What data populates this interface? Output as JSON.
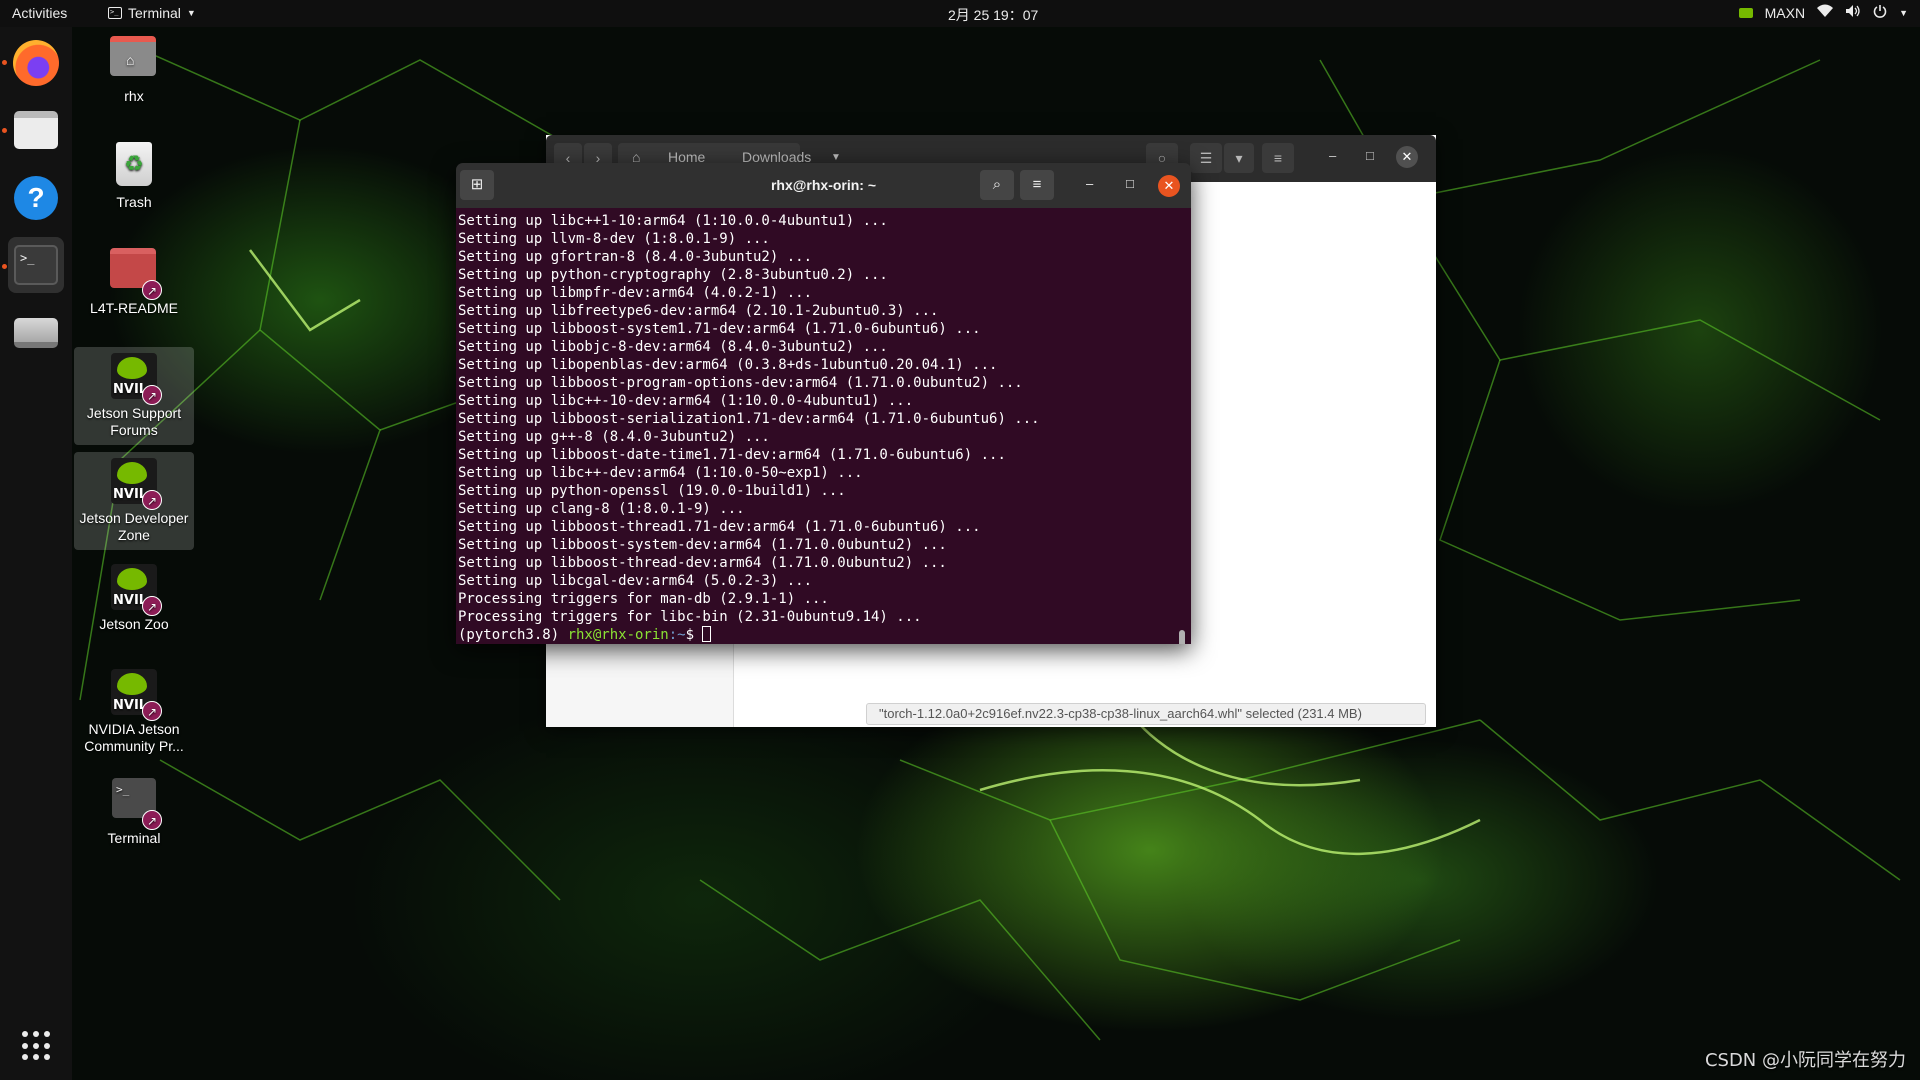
{
  "topbar": {
    "activities": "Activities",
    "app_menu_label": "Terminal",
    "clock": "2月 25 19：07",
    "power_mode": "MAXN"
  },
  "dock": {
    "items": [
      {
        "name": "Firefox",
        "icon": "firefox-icon",
        "running": true
      },
      {
        "name": "Files",
        "icon": "files-icon",
        "running": true
      },
      {
        "name": "Help",
        "icon": "help-icon",
        "running": false
      },
      {
        "name": "Terminal",
        "icon": "terminal-icon",
        "running": true,
        "active": true
      },
      {
        "name": "Drive",
        "icon": "drive-icon",
        "running": false
      }
    ],
    "show_apps_icon": "apps-grid-icon"
  },
  "desktop": {
    "icons": [
      {
        "label": "rhx",
        "icon": "home-folder-icon"
      },
      {
        "label": "Trash",
        "icon": "trash-icon"
      },
      {
        "label": "L4T-README",
        "icon": "folder-link-icon"
      },
      {
        "label": "Jetson Support Forums",
        "icon": "nvidia-link-icon"
      },
      {
        "label": "Jetson Developer Zone",
        "icon": "nvidia-link-icon"
      },
      {
        "label": "Jetson Zoo",
        "icon": "nvidia-link-icon"
      },
      {
        "label": "NVIDIA Jetson Community Pr...",
        "icon": "nvidia-link-icon"
      },
      {
        "label": "Terminal",
        "icon": "terminal-link-icon"
      }
    ],
    "nvidia_logo_text": "NVIL"
  },
  "files_window": {
    "crumb_home": "Home",
    "crumb_current": "Downloads",
    "status": "\"torch-1.12.0a0+2c916ef.nv22.3-cp38-cp38-linux_aarch64.whl\" selected  (231.4 MB)"
  },
  "terminal": {
    "title": "rhx@rhx-orin: ~",
    "lines": [
      "Setting up libc++1-10:arm64 (1:10.0.0-4ubuntu1) ...",
      "Setting up llvm-8-dev (1:8.0.1-9) ...",
      "Setting up gfortran-8 (8.4.0-3ubuntu2) ...",
      "Setting up python-cryptography (2.8-3ubuntu0.2) ...",
      "Setting up libmpfr-dev:arm64 (4.0.2-1) ...",
      "Setting up libfreetype6-dev:arm64 (2.10.1-2ubuntu0.3) ...",
      "Setting up libboost-system1.71-dev:arm64 (1.71.0-6ubuntu6) ...",
      "Setting up libobjc-8-dev:arm64 (8.4.0-3ubuntu2) ...",
      "Setting up libopenblas-dev:arm64 (0.3.8+ds-1ubuntu0.20.04.1) ...",
      "Setting up libboost-program-options-dev:arm64 (1.71.0.0ubuntu2) ...",
      "Setting up libc++-10-dev:arm64 (1:10.0.0-4ubuntu1) ...",
      "Setting up libboost-serialization1.71-dev:arm64 (1.71.0-6ubuntu6) ...",
      "Setting up g++-8 (8.4.0-3ubuntu2) ...",
      "Setting up libboost-date-time1.71-dev:arm64 (1.71.0-6ubuntu6) ...",
      "Setting up libc++-dev:arm64 (1:10.0-50~exp1) ...",
      "Setting up python-openssl (19.0.0-1build1) ...",
      "Setting up clang-8 (1:8.0.1-9) ...",
      "Setting up libboost-thread1.71-dev:arm64 (1.71.0-6ubuntu6) ...",
      "Setting up libboost-system-dev:arm64 (1.71.0.0ubuntu2) ...",
      "Setting up libboost-thread-dev:arm64 (1.71.0.0ubuntu2) ...",
      "Setting up libcgal-dev:arm64 (5.0.2-3) ...",
      "Processing triggers for man-db (2.9.1-1) ...",
      "Processing triggers for libc-bin (2.31-0ubuntu9.14) ..."
    ],
    "prompt_env": "(pytorch3.8) ",
    "prompt_user": "rhx@rhx-orin",
    "prompt_path": ":~",
    "prompt_symbol": "$ "
  },
  "watermark": "CSDN @小阮同学在努力",
  "colors": {
    "terminal_bg": "#300a24",
    "ubuntu_orange": "#e95420",
    "nvidia_green": "#76b900",
    "prompt_user": "#8ae234",
    "prompt_path": "#729fcf"
  }
}
